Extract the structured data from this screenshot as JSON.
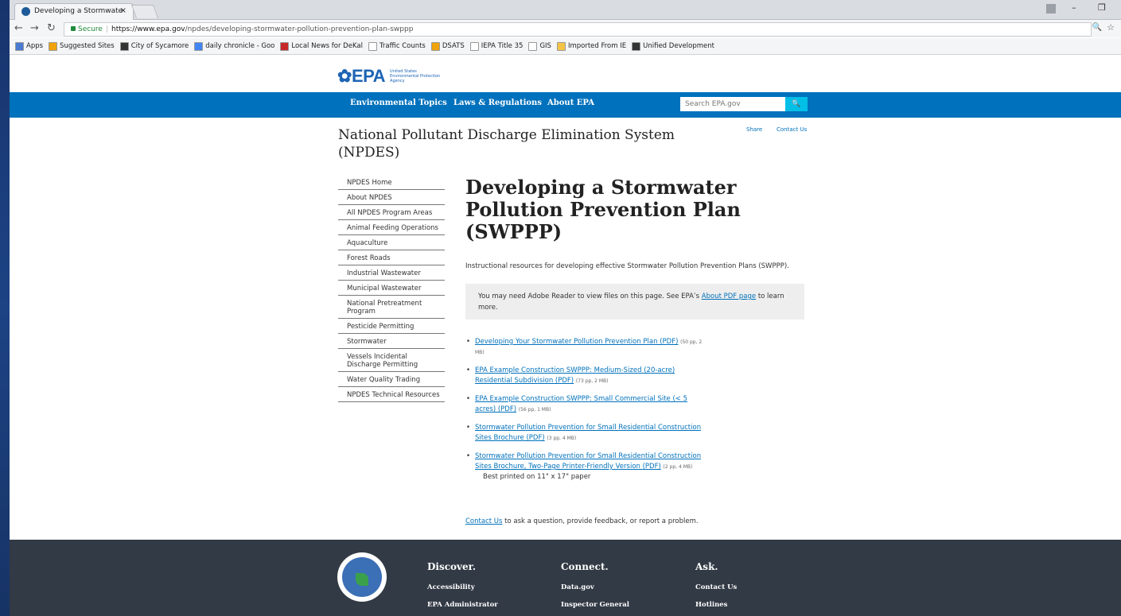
{
  "browser": {
    "tab_title": "Developing a Stormwate",
    "tab_close": "×",
    "url_secure": "Secure",
    "url_host": "https://www.epa.gov",
    "url_path": "/npdes/developing-stormwater-pollution-prevention-plan-swppp",
    "bookmarks": [
      {
        "label": "Apps",
        "color": "#4a7bd1"
      },
      {
        "label": "Suggested Sites",
        "color": "#f0a30a"
      },
      {
        "label": "City of Sycamore",
        "color": "#333333"
      },
      {
        "label": "daily chronicle - Goo",
        "color": "#4285f4"
      },
      {
        "label": "Local News for DeKal",
        "color": "#c62828"
      },
      {
        "label": "Traffic Counts",
        "color": "#ffffff"
      },
      {
        "label": "DSATS",
        "color": "#f0a30a"
      },
      {
        "label": "IEPA Title 35",
        "color": "#ffffff"
      },
      {
        "label": "GIS",
        "color": "#ffffff"
      },
      {
        "label": "Imported From IE",
        "color": "#f6c445"
      },
      {
        "label": "Unified Development",
        "color": "#333333"
      }
    ]
  },
  "header": {
    "logo_text": "EPA",
    "logo_sub_1": "United States",
    "logo_sub_2": "Environmental Protection",
    "logo_sub_3": "Agency",
    "nav": [
      "Environmental Topics",
      "Laws & Regulations",
      "About EPA"
    ],
    "search_placeholder": "Search EPA.gov",
    "search_button": "🔍",
    "share": "Share",
    "contact": "Contact Us"
  },
  "program_title": "National Pollutant Discharge Elimination System (NPDES)",
  "sidenav": [
    "NPDES Home",
    "About NPDES",
    "All NPDES Program Areas",
    "Animal Feeding Operations",
    "Aquaculture",
    "Forest Roads",
    "Industrial Wastewater",
    "Municipal Wastewater",
    "National Pretreatment Program",
    "Pesticide Permitting",
    "Stormwater",
    "Vessels Incidental Discharge Permitting",
    "Water Quality Trading",
    "NPDES Technical Resources"
  ],
  "main": {
    "title": "Developing a Stormwater Pollution Prevention Plan (SWPPP)",
    "intro": "Instructional resources for developing effective Stormwater Pollution Prevention Plans (SWPPP).",
    "notice_pre": "You may need Adobe Reader to view files on this page. See EPA’s",
    "notice_link": "About PDF page",
    "notice_post": "to learn more.",
    "resources": [
      {
        "link": "Developing Your Stormwater Pollution Prevention Plan (PDF)",
        "meta": "(50 pp, 2 MB)"
      },
      {
        "link": "EPA Example Construction SWPPP: Medium-Sized (20-acre) Residential Subdivision (PDF)",
        "meta": "(73 pp, 2 MB)"
      },
      {
        "link": "EPA Example Construction SWPPP: Small Commercial Site (< 5 acres) (PDF)",
        "meta": "(56 pp, 1 MB)"
      },
      {
        "link": "Stormwater Pollution Prevention for Small Residential Construction Sites Brochure (PDF)",
        "meta": "(3 pp, 4 MB)"
      },
      {
        "link": "Stormwater Pollution Prevention for Small Residential Construction Sites Brochure, Two-Page Printer-Friendly Version (PDF)",
        "meta": "(2 pp, 4 MB)",
        "note": "Best printed on 11\" x 17\" paper"
      }
    ],
    "contact_link": "Contact Us",
    "contact_text": "to ask a question, provide feedback, or report a problem."
  },
  "footer": {
    "columns": [
      {
        "heading": "Discover.",
        "links": [
          "Accessibility",
          "EPA Administrator"
        ]
      },
      {
        "heading": "Connect.",
        "links": [
          "Data.gov",
          "Inspector General"
        ]
      },
      {
        "heading": "Ask.",
        "links": [
          "Contact Us",
          "Hotlines"
        ]
      }
    ]
  },
  "colors": {
    "nav_blue": "#0071bc",
    "footer_bg": "#323a45",
    "search_button": "#02bfe7"
  }
}
